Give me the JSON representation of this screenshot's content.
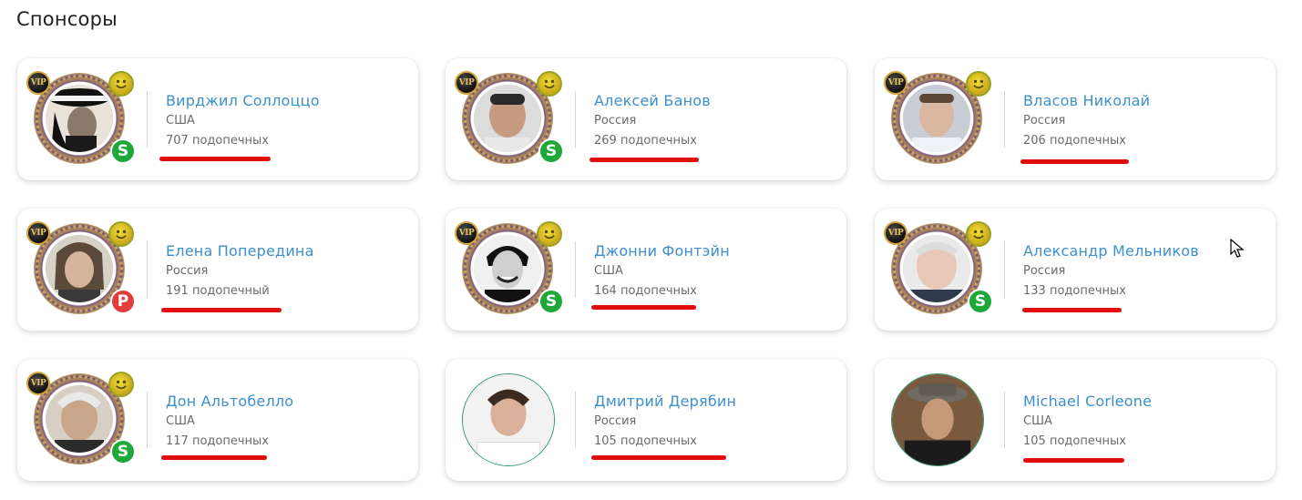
{
  "page": {
    "title": "Спонсоры"
  },
  "sponsors": [
    {
      "name": "Вирджил Соллоццо",
      "country": "США",
      "count": "707 подопечных",
      "vip": "VIP",
      "status": "S",
      "status_color": "#1fa83a"
    },
    {
      "name": "Алексей Банов",
      "country": "Россия",
      "count": "269 подопечных",
      "vip": "VIP",
      "status": "S",
      "status_color": "#1fa83a"
    },
    {
      "name": "Власов Николай",
      "country": "Россия",
      "count": "206 подопечных",
      "vip": "VIP",
      "status": "",
      "status_color": ""
    },
    {
      "name": "Елена Попередина",
      "country": "Россия",
      "count": "191 подопечный",
      "vip": "VIP",
      "status": "P",
      "status_color": "#e43c3c"
    },
    {
      "name": "Джонни Фонтэйн",
      "country": "США",
      "count": "164 подопечных",
      "vip": "VIP",
      "status": "S",
      "status_color": "#1fa83a"
    },
    {
      "name": "Александр Мельников",
      "country": "Россия",
      "count": "133 подопечных",
      "vip": "VIP",
      "status": "S",
      "status_color": "#1fa83a"
    },
    {
      "name": "Дон Альтобелло",
      "country": "США",
      "count": "117 подопечных",
      "vip": "VIP",
      "status": "S",
      "status_color": "#1fa83a"
    },
    {
      "name": "Дмитрий Дерябин",
      "country": "Россия",
      "count": "105 подопечных",
      "vip": "",
      "status": "",
      "status_color": ""
    },
    {
      "name": "Michael Corleone",
      "country": "США",
      "count": "105 подопечных",
      "vip": "",
      "status": "",
      "status_color": ""
    }
  ],
  "colors": {
    "link": "#3d8fce",
    "underline": "#e10d0d",
    "muted": "#6b6b6b"
  },
  "icons": {
    "vip": "vip-badge-icon",
    "smile": "smile-badge-icon",
    "cursor": "mouse-cursor-icon"
  }
}
